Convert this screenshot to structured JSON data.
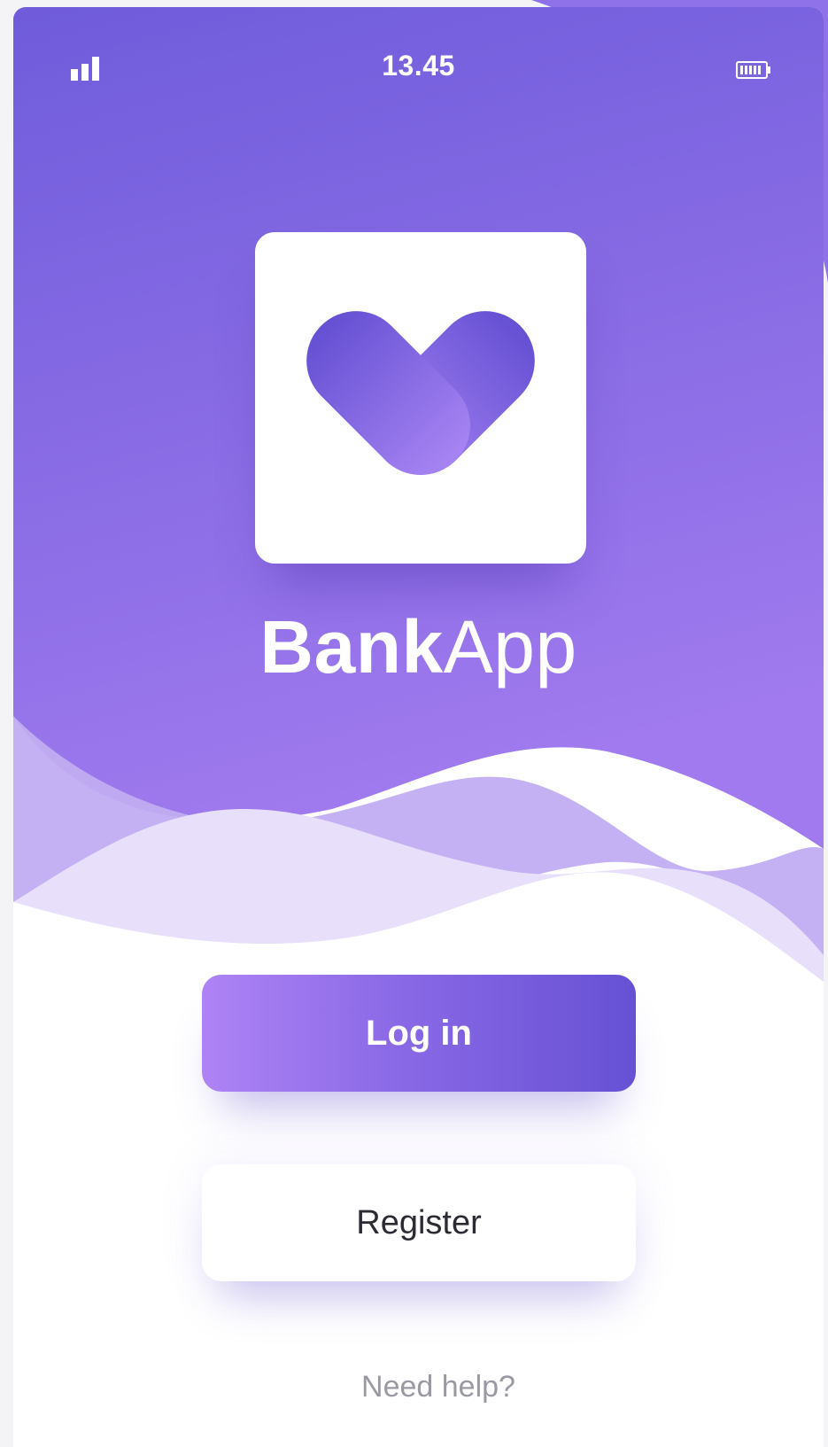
{
  "status_bar": {
    "time": "13.45",
    "signal_icon": "signal-bars-icon",
    "battery_icon": "battery-icon"
  },
  "logo": {
    "icon": "bankapp-logo-icon"
  },
  "brand": {
    "name_bold": "Bank",
    "name_light": "App"
  },
  "actions": {
    "login_label": "Log in",
    "register_label": "Register",
    "help_label": "Need help?"
  },
  "colors": {
    "gradient_top": "#6f5cdb",
    "gradient_bottom": "#9d77ec",
    "button_gradient_start": "#ae83f5",
    "button_gradient_end": "#6651d4",
    "wave_light": "#e8e0fb",
    "wave_mid": "#c1adf2",
    "help_text": "#9a99a3"
  }
}
